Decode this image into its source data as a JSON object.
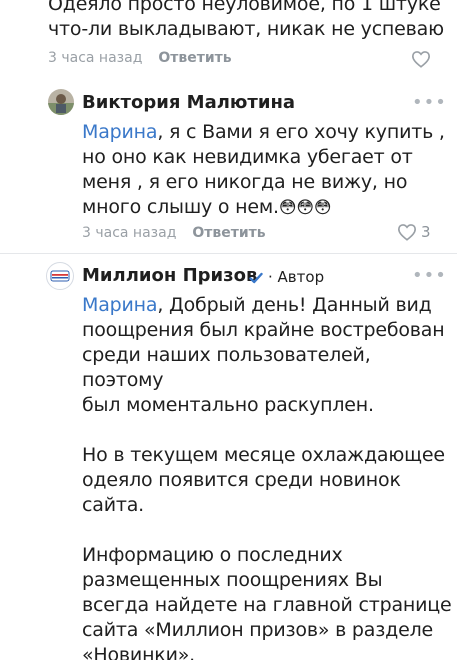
{
  "comments": [
    {
      "text_lines": [
        "Одеяло просто неуловимое, по 1 штуке",
        "что-ли выкладывают, никак не успеваю"
      ],
      "time": "3 часа назад",
      "reply": "Ответить"
    },
    {
      "author": "Виктория Малютина",
      "mention": "Марина",
      "text_first": ", я с Вами я его хочу купить ,",
      "text_lines": [
        "но оно как невидимка убегает от",
        "меня , я его никогда не вижу, но",
        "много слышу о нем."
      ],
      "emoji": "😳😳😳",
      "time": "3 часа назад",
      "reply": "Ответить",
      "likes": "3"
    },
    {
      "author": "Миллион Призов",
      "badge": "Автор",
      "mention": "Марина",
      "text_first": ", Добрый день! Данный вид",
      "paragraph1": [
        "поощрения был крайне востребован",
        "среди наших пользователей, поэтому",
        "был моментально раскуплен."
      ],
      "paragraph2": [
        "Но в текущем месяце охлаждающее",
        "одеяло появится среди новинок",
        "сайта."
      ],
      "paragraph3": [
        "Информацию о последних",
        "размещенных поощрениях Вы",
        "всегда найдете на главной странице",
        "сайта «Миллион призов» в разделе",
        "«Новинки»."
      ]
    }
  ],
  "icons": {
    "more": "more-dots-icon",
    "heart": "heart-icon",
    "verified": "verified-check-icon",
    "accent": "#3a78c9"
  }
}
